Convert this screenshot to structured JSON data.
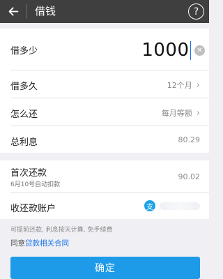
{
  "header": {
    "title": "借钱",
    "help_glyph": "?"
  },
  "borrow_amount": {
    "label": "借多少",
    "value": "1000"
  },
  "duration": {
    "label": "借多久",
    "value": "12个月"
  },
  "repayment": {
    "label": "怎么还",
    "value": "每月等额"
  },
  "interest": {
    "label": "总利息",
    "value": "80.29"
  },
  "first_payment": {
    "label": "首次还款",
    "sub": "6月10号自动扣款",
    "value": "90.02"
  },
  "account": {
    "label": "收还款账户",
    "icon": "alipay-icon",
    "icon_glyph": "支"
  },
  "note": "可提前还款, 利息按天计算, 免手续费",
  "agreement": {
    "prefix": "同意",
    "link": "贷款相关合同"
  },
  "confirm_label": "确定",
  "colors": {
    "header_bg": "#3f3f3f",
    "accent": "#1e9be8",
    "link": "#1a73e8",
    "background": "#efeff4"
  }
}
